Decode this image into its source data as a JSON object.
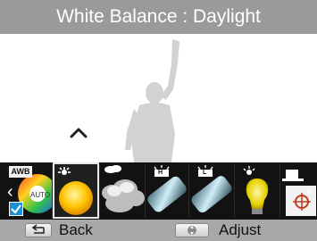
{
  "title": "White Balance : Daylight",
  "options": [
    {
      "name": "awb",
      "badge": "AWB"
    },
    {
      "name": "daylight"
    },
    {
      "name": "cloudy"
    },
    {
      "name": "fluorescent-h",
      "badge": "H"
    },
    {
      "name": "fluorescent-l",
      "badge": "L"
    },
    {
      "name": "tungsten"
    },
    {
      "name": "custom-set"
    }
  ],
  "selected_option": "daylight",
  "auto_label": "AUTO",
  "footer": {
    "back_label": "Back",
    "adjust_label": "Adjust"
  },
  "colors": {
    "title_bar": "#9a9a9a",
    "footer_bar": "#a8a8a8",
    "strip": "#121212",
    "check": "#1e8fd6"
  }
}
